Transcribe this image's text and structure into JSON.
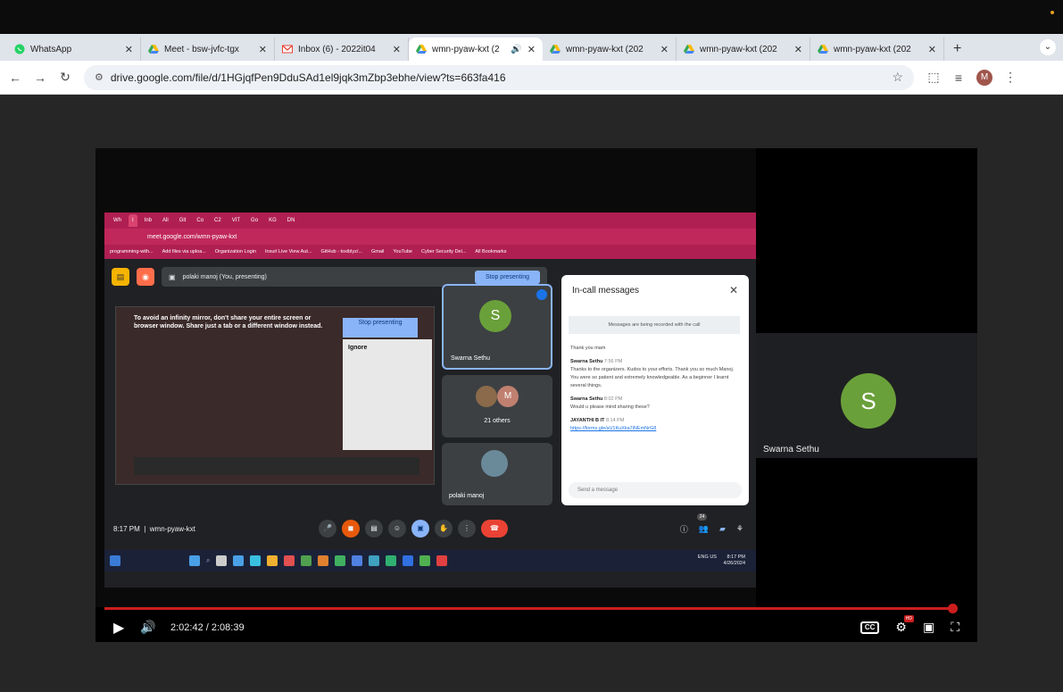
{
  "browser": {
    "tabs": [
      {
        "label": "WhatsApp",
        "icon": "whatsapp-icon",
        "active": false
      },
      {
        "label": "Meet - bsw-jvfc-tgx",
        "icon": "google-drive-icon",
        "active": false
      },
      {
        "label": "Inbox (6) - 2022it04",
        "icon": "gmail-icon",
        "active": false
      },
      {
        "label": "wmn-pyaw-kxt (2",
        "icon": "google-drive-icon",
        "active": true
      },
      {
        "label": "wmn-pyaw-kxt (202",
        "icon": "google-drive-icon",
        "active": false
      },
      {
        "label": "wmn-pyaw-kxt (202",
        "icon": "google-drive-icon",
        "active": false
      },
      {
        "label": "wmn-pyaw-kxt (202",
        "icon": "google-drive-icon",
        "active": false
      }
    ],
    "url": "drive.google.com/file/d/1HGjqfPen9DduSAd1el9jqk3mZbp3ebhe/view?ts=663fa416",
    "profile_initial": "M"
  },
  "meeting": {
    "inner_tabs": [
      "Wh",
      "I",
      "Inb",
      "All",
      "Git",
      "Co",
      "C2",
      "VIT",
      "Go",
      "KG",
      "DN"
    ],
    "inner_url": "meet.google.com/wmn-pyaw-kxt",
    "bookmarks": [
      "programming-with...",
      "Add files via uploa...",
      "Organization Login",
      "Insurl Live View Aut...",
      "GitHub - toxiblyz/...",
      "Gmail",
      "YouTube",
      "Cyber Security Del...",
      "All Bookmarks"
    ],
    "presenting_label": "polaki manoj (You, presenting)",
    "stop_presenting": "Stop presenting",
    "warning": "To avoid an infinity mirror, don't share your entire screen or browser window. Share just a tab or a different window instead.",
    "stop_presenting_small": "Stop presenting",
    "ignore": "Ignore",
    "participant_main_initial": "S",
    "participant_main_name": "Swarna Sethu",
    "others_initial": "M",
    "others_label": "21 others",
    "self_name": "polaki manoj",
    "chat": {
      "title": "In-call messages",
      "note": "Messages are being recorded with the call",
      "first_msg": "Thank you mam",
      "sender1": "Swarna Sethu",
      "time1": "7:56 PM",
      "msg1": "Thanks to the organizers. Kudos to your efforts. Thank you so much Manoj. You were so patient and extremely knowledgeable. As a beginner I learnt several things.",
      "sender2": "Swarna Sethu",
      "time2": "8:02 PM",
      "msg2": "Would u please mind sharing these?",
      "sender3": "JAYANTHI B IT",
      "time3": "8:14 PM",
      "link3": "https://forms.gle/aV1KuXka7iNEmNrG8",
      "send_placeholder": "Send a message"
    },
    "time_code": "8:17 PM",
    "meeting_code": "wmn-pyaw-kxt",
    "people_count": "24",
    "taskbar_lang": "ENG US",
    "taskbar_time": "8:17 PM",
    "taskbar_date": "4/26/2024"
  },
  "side_participant": {
    "initial": "S",
    "name": "Swarna Sethu"
  },
  "player": {
    "time": "2:02:42 / 2:08:39",
    "progress_fraction": 0.9832,
    "hd_badge": "HD",
    "cc_label": "CC"
  }
}
